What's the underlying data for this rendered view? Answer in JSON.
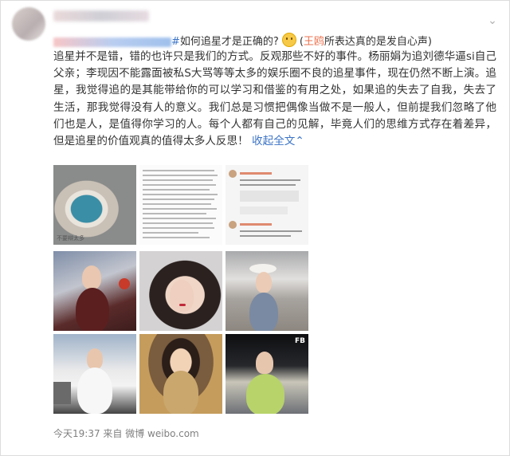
{
  "post": {
    "line1_topic_tail": "#",
    "line1_title": "如何追星才是正确的?",
    "line1_open": "(",
    "line1_mention": "王鸥",
    "line1_suffix": "所表达真的是发自心声)",
    "body": "追星并不是错，错的也许只是我们的方式。反观那些不好的事件。杨丽娟为追刘德华逼si自己父亲；李现因不能露面被私S大骂等等太多的娱乐圈不良的追星事件，现在仍然不断上演。追星，我觉得追的是其能带给你的可以学习和借鉴的有用之处，如果追的失去了自我，失去了生活，那我觉得没有人的意义。我们总是习惯把偶像当做不是一般人，但前提我们忽略了他们也是人，是值得你学习的人。每个人都有自己的见解，毕竟人们的思维方式存在着差异，但是追星的价值观真的值得太多人反思！",
    "collapse": "收起全文",
    "collapse_arrow": "^",
    "caption": "今天19:37  来自 微博 weibo.com",
    "photo1_label": "不要辩太多",
    "fb_mark": "FB"
  },
  "icons": {
    "more": "chevron-down-icon"
  }
}
